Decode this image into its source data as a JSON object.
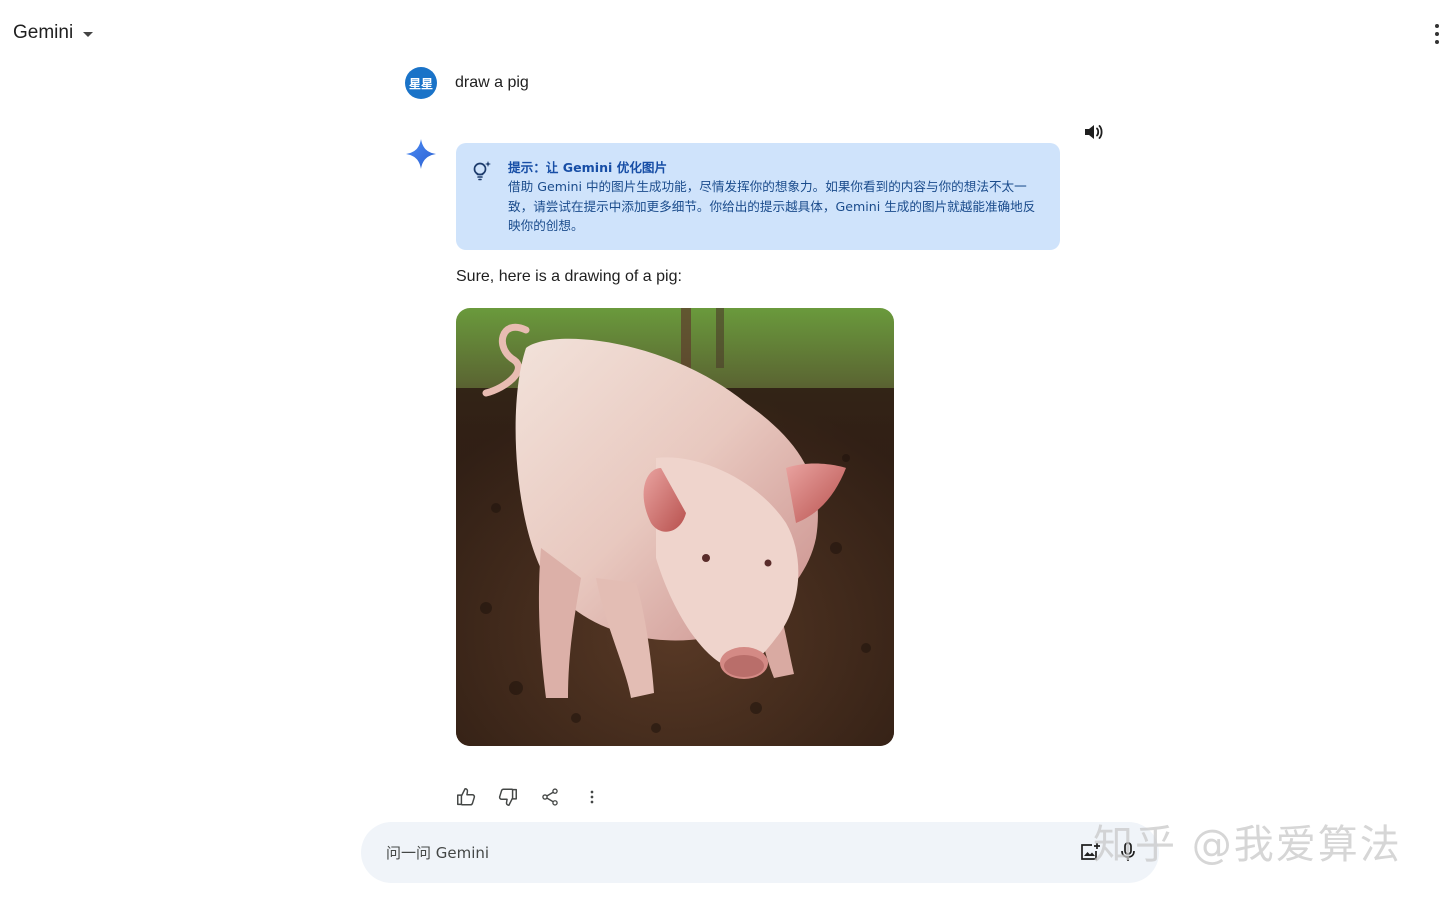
{
  "header": {
    "model_name": "Gemini"
  },
  "user_message": {
    "avatar_text": "星星",
    "text": "draw a pig"
  },
  "response": {
    "tip_title": "提示：让 Gemini 优化图片",
    "tip_body": "借助 Gemini 中的图片生成功能，尽情发挥你的想象力。如果你看到的内容与你的想法不太一致，请尝试在提示中添加更多细节。你给出的提示越具体，Gemini 生成的图片就越能准确地反映你的创想。",
    "text": "Sure, here is a drawing of a pig:",
    "image_icon": "pig-photo"
  },
  "actions": [
    "thumbs-up-icon",
    "thumbs-down-icon",
    "share-icon",
    "more-vert-icon"
  ],
  "input": {
    "placeholder": "问一问 Gemini"
  },
  "watermark": "知乎 @我爱算法",
  "colors": {
    "tip_background": "#cfe3fb",
    "tip_text": "#1b4c8c",
    "avatar": "#1a73c8",
    "input_background": "#f0f4f9"
  }
}
